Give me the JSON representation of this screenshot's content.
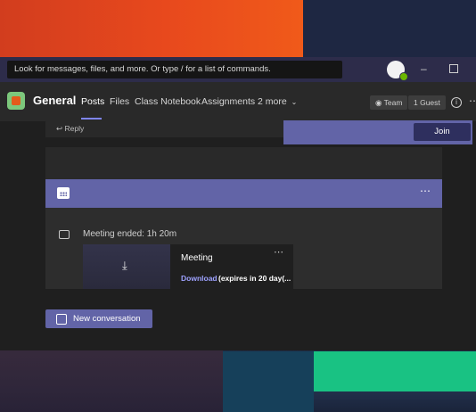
{
  "search": {
    "placeholder": "Look for messages, files, and more. Or type / for a list of commands."
  },
  "window_controls": {
    "minimize": "–"
  },
  "channel": {
    "name": "General",
    "tabs": [
      "Posts",
      "Files",
      "Class Notebook",
      "Assignments",
      "2 more"
    ],
    "team_chip": "Team",
    "guest_chip": "1 Guest"
  },
  "thread": {
    "reply_label": "Reply",
    "join_label": "Join",
    "meeting_status": "Meeting ended: 1h 20m",
    "recording": {
      "title": "Meeting",
      "download_label": "Download",
      "expiry": "(expires in 20 day(..."
    }
  },
  "composer": {
    "new_conversation_label": "New conversation"
  },
  "colors": {
    "accent": "#6264a7",
    "join_button": "#2e2f5e",
    "link": "#9ea2ff",
    "presence": "#6bb700"
  }
}
